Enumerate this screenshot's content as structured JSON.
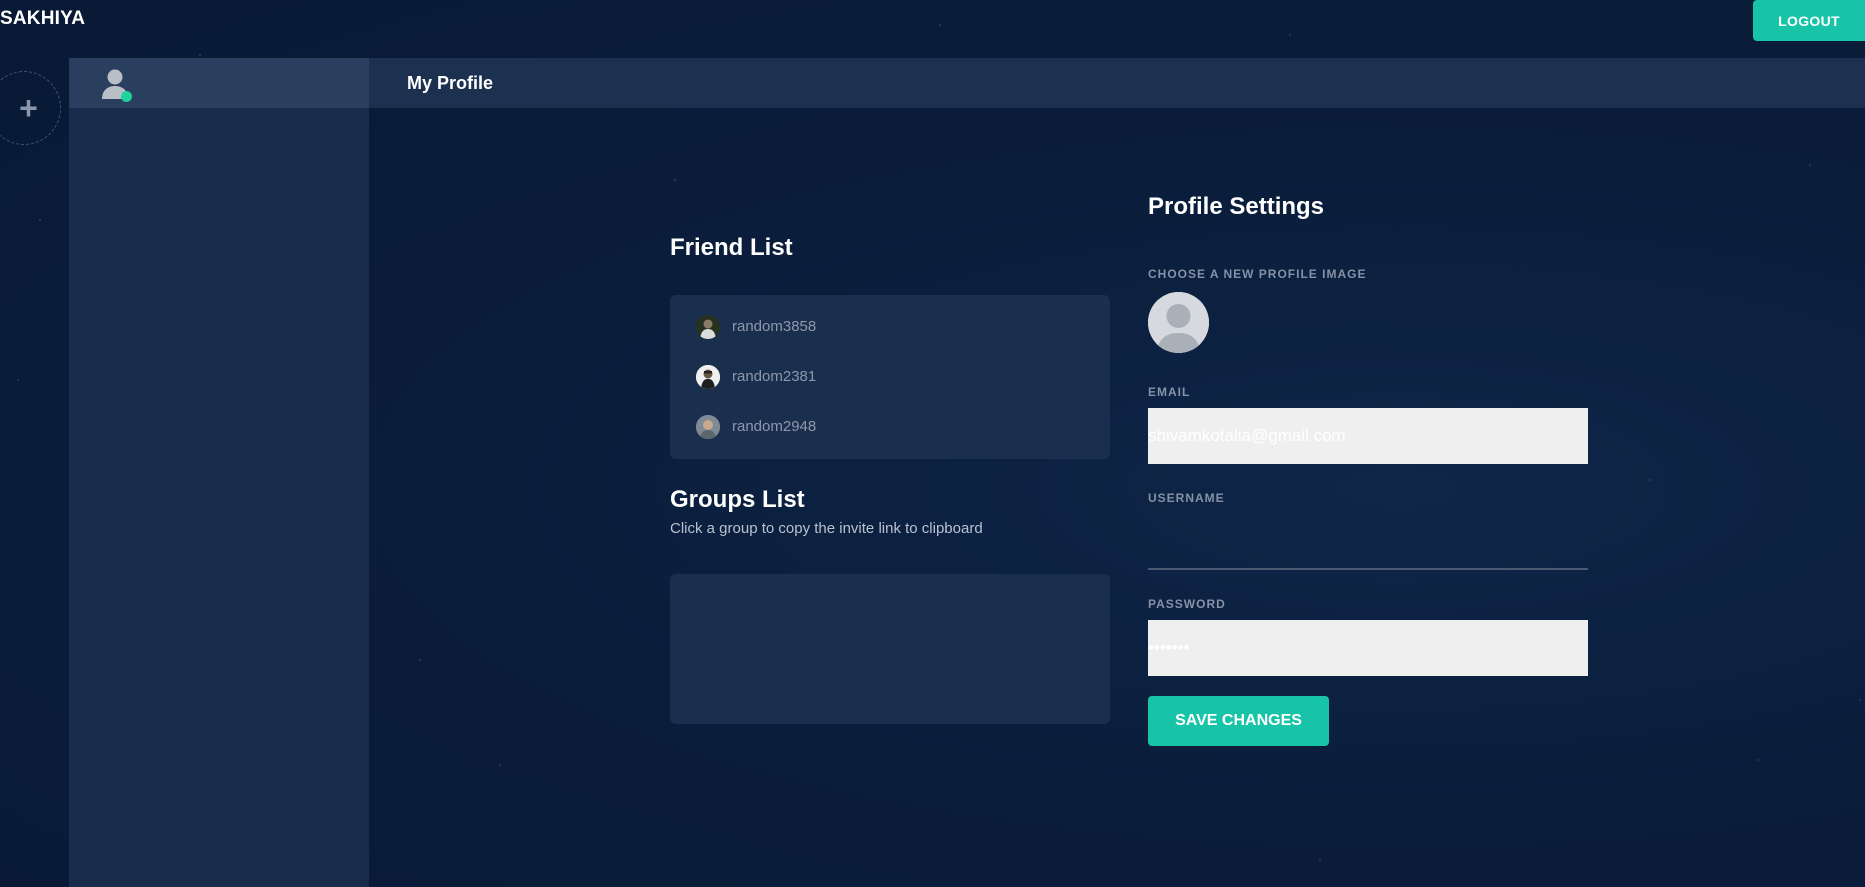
{
  "app": {
    "brand": "SAKHIYA",
    "logout_label": "LOGOUT"
  },
  "rail": {
    "add_icon": "plus-icon"
  },
  "sidebar": {
    "user_icon": "user-icon",
    "status_color": "#1ed39e"
  },
  "header": {
    "title": "My Profile"
  },
  "friends": {
    "title": "Friend List",
    "items": [
      {
        "name": "random3858"
      },
      {
        "name": "random2381"
      },
      {
        "name": "random2948"
      }
    ]
  },
  "groups": {
    "title": "Groups List",
    "subtitle": "Click a group to copy the invite link to clipboard",
    "items": []
  },
  "profile": {
    "title": "Profile Settings",
    "image_label": "CHOOSE A NEW PROFILE IMAGE",
    "email_label": "EMAIL",
    "email_value": "shivamkotalia@gmail.com",
    "username_label": "USERNAME",
    "username_value": "",
    "password_label": "PASSWORD",
    "password_value": "1234567",
    "save_label": "SAVE CHANGES"
  },
  "colors": {
    "accent": "#18c4a8",
    "background": "#0a1d3b",
    "panel": "#1a2e4e"
  }
}
